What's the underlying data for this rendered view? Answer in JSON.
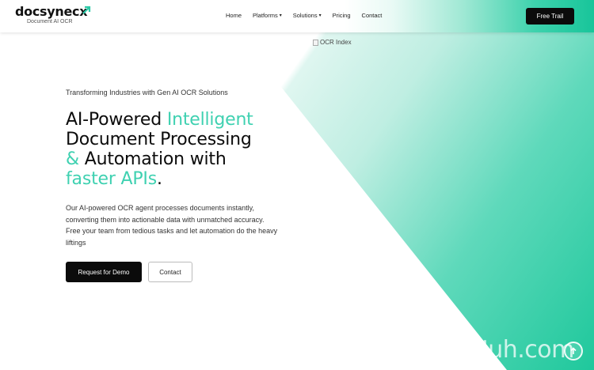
{
  "brand": {
    "name": "docsynecx",
    "tagline": "Document AI OCR",
    "arrow_icon": "arrow-up-right-icon",
    "accent_color": "#3fd1b1"
  },
  "nav": {
    "items": [
      {
        "label": "Home",
        "dropdown": false
      },
      {
        "label": "Platforms",
        "dropdown": true
      },
      {
        "label": "Solutions",
        "dropdown": true
      },
      {
        "label": "Pricing",
        "dropdown": false
      },
      {
        "label": "Contact",
        "dropdown": false
      }
    ],
    "chevron": "▾"
  },
  "header_cta": {
    "label": "Free Trail"
  },
  "hero_image": {
    "alt": "OCR Index"
  },
  "hero": {
    "eyebrow": "Transforming Industries with Gen AI OCR Solutions",
    "headline": {
      "p1": "AI-Powered ",
      "p2": "Intelligent",
      "p3": "Document Processing",
      "p4": "&",
      "p5": " Automation with",
      "p6": "faster APIs",
      "p7": "."
    },
    "description": "Our AI-powered OCR agent processes documents instantly, converting them into actionable data with unmatched accuracy. Free your team from tedious tasks and let automation do the heavy liftings",
    "primary_button": "Request for Demo",
    "secondary_button": "Contact"
  },
  "overlay": {
    "watermark": "AiJuh.com",
    "scroll_icon": "scroll-top-icon"
  }
}
